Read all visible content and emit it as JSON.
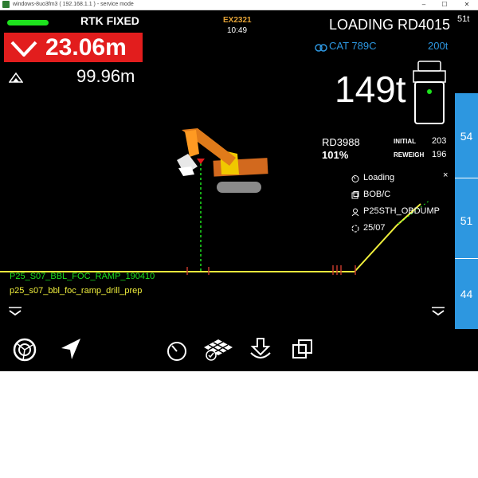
{
  "window": {
    "title": "windows-8uo3fm3 ( 192.168.1.1 ) - service mode",
    "minimize": "–",
    "maximize": "☐",
    "close": "✕"
  },
  "header": {
    "gps_status": "RTK FIXED",
    "machine_id": "EX2321",
    "time": "10:49"
  },
  "cut": {
    "value": "23.06m"
  },
  "elevation": {
    "value": "99.96m"
  },
  "loading": {
    "title": "LOADING RD4015",
    "truck_model": "CAT 789C",
    "truck_capacity": "200t",
    "payload": "149t"
  },
  "scale": {
    "top_label": "51t",
    "labels": [
      "54",
      "51",
      "44"
    ]
  },
  "previous_load": {
    "truck": "RD3988",
    "percent": "101%",
    "initial_label": "INITIAL",
    "initial_value": "203",
    "reweigh_label": "REWEIGH",
    "reweigh_value": "196"
  },
  "info_panel": {
    "items": [
      {
        "icon": "timer-icon",
        "text": "Loading"
      },
      {
        "icon": "material-icon",
        "text": "BOB/C"
      },
      {
        "icon": "location-icon",
        "text": "P25STH_OBDUMP"
      },
      {
        "icon": "calendar-icon",
        "text": "25/07"
      }
    ],
    "close": "×"
  },
  "design": {
    "surface_green": "P25_S07_BBL_FOC_RAMP_190410",
    "surface_yellow": "p25_s07_bbl_foc_ramp_drill_prep"
  },
  "toolbar": {
    "items": [
      "camera-icon",
      "navigation-icon",
      "timer-icon",
      "grid-check-icon",
      "download-icon",
      "copy-icon"
    ]
  },
  "colors": {
    "cut_red": "#e21d1d",
    "gps_green": "#1de21d",
    "accent_blue": "#2d97e0",
    "design_yellow": "#f0ef3c",
    "machine_orange": "#e3a236"
  }
}
